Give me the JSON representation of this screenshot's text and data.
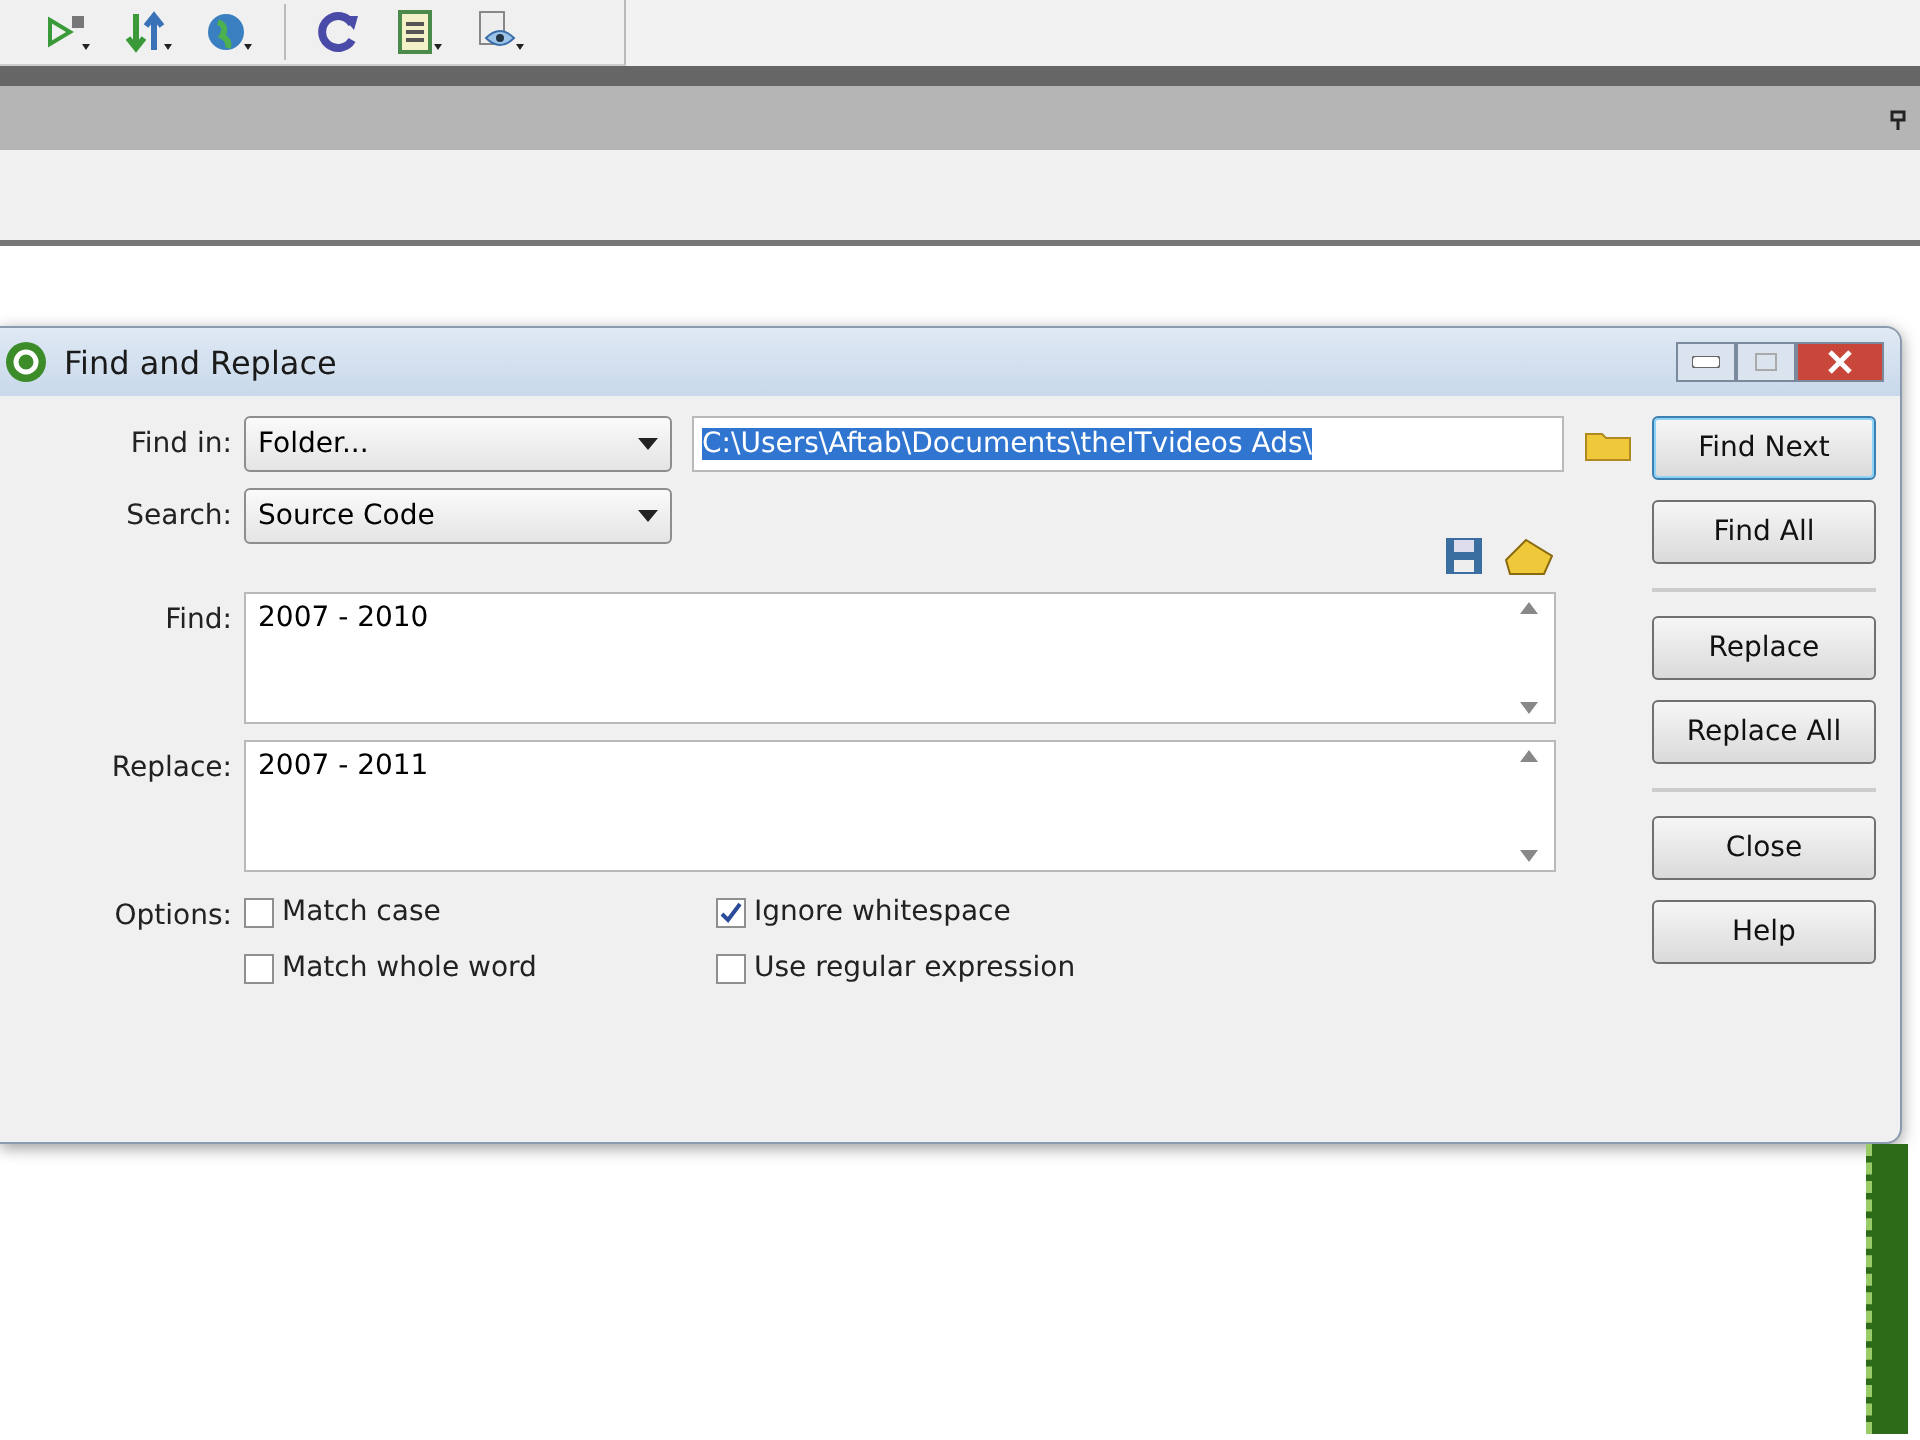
{
  "dialog": {
    "title": "Find and Replace",
    "find_in": {
      "label": "Find in:",
      "value": "Folder...",
      "path": "C:\\Users\\Aftab\\Documents\\theITvideos Ads\\"
    },
    "search": {
      "label": "Search:",
      "value": "Source Code"
    },
    "find": {
      "label": "Find:",
      "value": "2007 - 2010"
    },
    "replace": {
      "label": "Replace:",
      "value": "2007 - 2011"
    },
    "options_label": "Options:",
    "options": [
      {
        "label": "Match case",
        "checked": false
      },
      {
        "label": "Ignore whitespace",
        "checked": true
      },
      {
        "label": "Match whole word",
        "checked": false
      },
      {
        "label": "Use regular expression",
        "checked": false
      }
    ],
    "buttons": [
      {
        "label": "Find Next",
        "selected": true
      },
      {
        "label": "Find All",
        "selected": false
      },
      {
        "label": "Replace",
        "selected": false
      },
      {
        "label": "Replace All",
        "selected": false
      },
      {
        "label": "Close",
        "selected": false
      },
      {
        "label": "Help",
        "selected": false
      }
    ]
  }
}
